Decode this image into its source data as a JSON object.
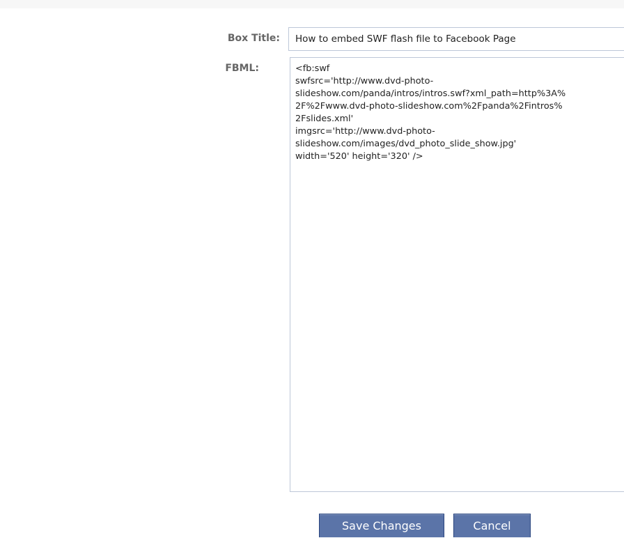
{
  "form": {
    "box_title_label": "Box Title:",
    "box_title_value": "How to embed SWF flash file  to Facebook Page",
    "fbml_label": "FBML:",
    "fbml_value": "<fb:swf\nswfsrc='http://www.dvd-photo-\nslideshow.com/panda/intros/intros.swf?xml_path=http%3A%\n2F%2Fwww.dvd-photo-slideshow.com%2Fpanda%2Fintros%\n2Fslides.xml'\nimgsrc='http://www.dvd-photo-\nslideshow.com/images/dvd_photo_slide_show.jpg'\nwidth='520' height='320' />"
  },
  "actions": {
    "save_label": "Save Changes",
    "cancel_label": "Cancel"
  },
  "colors": {
    "button_bg": "#5b74a8",
    "button_border": "#29447e",
    "label_text": "#666666",
    "input_border": "#bdc7d8"
  }
}
